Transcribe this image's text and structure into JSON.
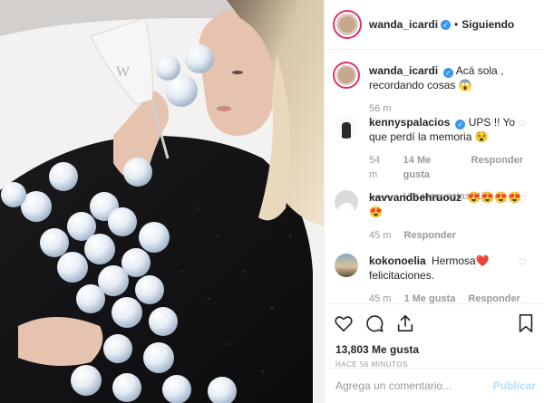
{
  "header": {
    "username": "wanda_icardi",
    "separator": "•",
    "follow_status": "Siguiendo"
  },
  "caption": {
    "username": "wanda_icardi",
    "text": "Acá sola , recordando cosas 😱",
    "time": "56 m"
  },
  "comments": [
    {
      "username": "kennyspalacios",
      "text": "UPS !! Yo que perdí la memoria 😵",
      "time": "54 m",
      "likes": "14 Me gusta",
      "reply": "Responder",
      "view_replies": "Ver respuestas (1)"
    },
    {
      "username": "kavvandbehruouz",
      "text": "😍😍😍😍😍",
      "time": "45 m",
      "reply": "Responder"
    },
    {
      "username": "kokonoelia",
      "text": "Hermosa❤️ felicitaciones.",
      "time": "45 m",
      "likes": "1 Me gusta",
      "reply": "Responder"
    }
  ],
  "actions": {
    "likes_count": "13,803 Me gusta",
    "time_ago": "HACE 56 MINUTOS"
  },
  "add_comment": {
    "placeholder": "Agrega un comentario...",
    "publish_label": "Publicar"
  },
  "photo": {
    "cup_text": "W"
  }
}
